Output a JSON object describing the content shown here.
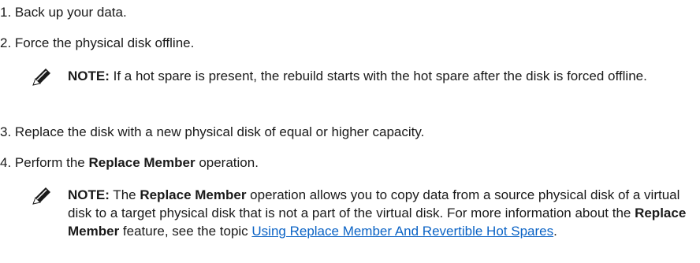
{
  "steps": [
    {
      "number": "1.",
      "text": "Back up your data."
    },
    {
      "number": "2.",
      "text": "Force the physical disk offline."
    },
    {
      "number": "3.",
      "text": "Replace the disk with a new physical disk of equal or higher capacity."
    },
    {
      "number": "4.",
      "text_before": "Perform the ",
      "strong": "Replace Member",
      "text_after": " operation."
    }
  ],
  "note1": {
    "label": "NOTE:",
    "text": " If a hot spare is present, the rebuild starts with the hot spare after the disk is forced offline."
  },
  "note2": {
    "label": "NOTE:",
    "t1": " The ",
    "s1": "Replace Member",
    "t2": " operation allows you to copy data from a source physical disk of a virtual disk to a target physical disk that is not a part of the virtual disk. For more information about the ",
    "s2": "Replace Member",
    "t3": " feature, see the topic ",
    "link": "Using Replace Member And Revertible Hot Spares",
    "t4": "."
  },
  "icon": "note-pencil-icon"
}
